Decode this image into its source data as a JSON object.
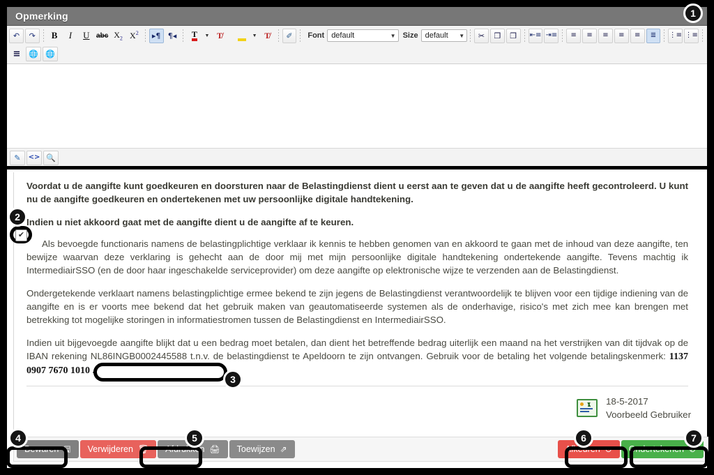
{
  "editor": {
    "title": "Opmerking",
    "toolbar_row1": [
      {
        "name": "undo-icon",
        "glyph": "↶"
      },
      {
        "name": "redo-icon",
        "glyph": "↷"
      },
      {
        "name": "bold-icon",
        "glyph": "B"
      },
      {
        "name": "italic-icon",
        "glyph": "I"
      },
      {
        "name": "underline-icon",
        "glyph": "U"
      },
      {
        "name": "strikethrough-icon",
        "glyph": "abc"
      },
      {
        "name": "subscript-icon",
        "glyph": "X"
      },
      {
        "name": "superscript-icon",
        "glyph": "X"
      },
      {
        "name": "ltr-paragraph-icon",
        "glyph": "¶"
      },
      {
        "name": "rtl-paragraph-icon",
        "glyph": "¶"
      },
      {
        "name": "text-color-icon",
        "glyph": "T"
      },
      {
        "name": "text-color-dropdown-icon",
        "glyph": "▾"
      },
      {
        "name": "remove-text-color-icon",
        "glyph": "T"
      },
      {
        "name": "highlight-color-icon",
        "glyph": "◇"
      },
      {
        "name": "highlight-dropdown-icon",
        "glyph": "▾"
      },
      {
        "name": "remove-highlight-icon",
        "glyph": "T"
      },
      {
        "name": "remove-format-icon",
        "glyph": "⌫"
      }
    ],
    "font_label": "Font",
    "font_value": "default",
    "size_label": "Size",
    "size_value": "default",
    "toolbar_row1_right": [
      {
        "name": "cut-icon",
        "glyph": "✂"
      },
      {
        "name": "copy-icon",
        "glyph": "❐"
      },
      {
        "name": "paste-word-icon",
        "glyph": "❐"
      },
      {
        "name": "outdent-icon",
        "glyph": "⇤"
      },
      {
        "name": "indent-icon",
        "glyph": "⇥"
      },
      {
        "name": "align-justify-icon",
        "glyph": "≡"
      },
      {
        "name": "align-left-icon",
        "glyph": "≡"
      },
      {
        "name": "align-center-icon",
        "glyph": "≡"
      },
      {
        "name": "align-right-icon",
        "glyph": "≡"
      },
      {
        "name": "align-block-icon",
        "glyph": "≡"
      },
      {
        "name": "align-full-icon",
        "glyph": "≡"
      },
      {
        "name": "numbered-list-icon",
        "glyph": "☰"
      },
      {
        "name": "bullet-list-icon",
        "glyph": "☰"
      }
    ],
    "toolbar_row2": [
      {
        "name": "horizontal-rule-icon",
        "glyph": "≡"
      },
      {
        "name": "insert-link-icon",
        "glyph": "🌐"
      },
      {
        "name": "remove-link-icon",
        "glyph": "🌐"
      }
    ],
    "footer_tabs": [
      {
        "name": "design-view-icon",
        "glyph": "✎"
      },
      {
        "name": "source-view-icon",
        "glyph": "<>"
      },
      {
        "name": "preview-icon",
        "glyph": "🔍"
      }
    ],
    "content": ""
  },
  "document": {
    "intro": "Voordat u de aangifte kunt goedkeuren en doorsturen naar de Belastingdienst dient u eerst aan te geven dat u de aangifte heeft gecontroleerd. U kunt nu de aangifte goedkeuren en ondertekenen met uw persoonlijke digitale handtekening.",
    "reject_note": "Indien u niet akkoord gaat met de aangifte dient u de aangifte af te keuren.",
    "checkbox_checked": true,
    "declaration": "Als bevoegde functionaris namens de belastingplichtige verklaar ik kennis te hebben genomen van en akkoord te gaan met de inhoud van deze aangifte, ten bewijze waarvan deze verklaring is gehecht aan de door mij met mijn persoonlijke digitale handtekening ondertekende aangifte. Tevens machtig ik IntermediairSSO (en de door haar ingeschakelde serviceprovider) om deze aangifte op elektronische wijze te verzenden aan de Belastingdienst.",
    "liability": "Ondergetekende verklaart namens belastingplichtige ermee bekend te zijn jegens de Belastingdienst verantwoordelijk te blijven voor een tijdige indiening van de aangifte en is er voorts mee bekend dat het gebruik maken van geautomatiseerde systemen als de onderhavige, risico's met zich mee kan brengen met betrekking tot mogelijke storingen in informatiestromen tussen de Belastingdienst en IntermediairSSO.",
    "payment_prefix": "Indien uit bijgevoegde aangifte blijkt dat u een bedrag moet betalen, dan dient het betreffende bedrag uiterlijk een maand na het verstrijken van dit tijdvak op de IBAN rekening NL86INGB0002445588 t.n.v. de belastingdienst te Apeldoorn te zijn ontvangen. Gebruik voor de betaling het volgende betalingskenmerk:",
    "payment_reference": "1137 0907 7670 1010 .",
    "signature": {
      "icon": "signature-stamp-icon",
      "date": "18-5-2017",
      "user": "Voorbeeld Gebruiker"
    }
  },
  "buttons": {
    "left": [
      {
        "name": "save-button",
        "label": "Bewaren",
        "icon": "save-icon",
        "glyph": "🖫",
        "style": "grey"
      },
      {
        "name": "delete-button",
        "label": "Verwijderen",
        "icon": "trash-icon",
        "glyph": "🗑",
        "style": "red"
      },
      {
        "name": "print-button",
        "label": "Afdrukken",
        "icon": "printer-icon",
        "glyph": "🖨",
        "style": "grey2"
      },
      {
        "name": "assign-button",
        "label": "Toewijzen",
        "icon": "assign-share-icon",
        "glyph": "⇗",
        "style": "grey2"
      }
    ],
    "right": [
      {
        "name": "reject-button",
        "label": "Afkeuren",
        "icon": "minus-circle-icon",
        "glyph": "⊖",
        "style": "red-dark"
      },
      {
        "name": "sign-button",
        "label": "Ondertekenen",
        "icon": "check-circle-icon",
        "glyph": "⊘",
        "style": "green"
      }
    ]
  },
  "callouts": [
    {
      "number": "1",
      "target": "editor-panel"
    },
    {
      "number": "2",
      "target": "agreement-checkbox"
    },
    {
      "number": "3",
      "target": "payment-reference"
    },
    {
      "number": "4",
      "target": "save-button"
    },
    {
      "number": "5",
      "target": "print-button"
    },
    {
      "number": "6",
      "target": "reject-button"
    },
    {
      "number": "7",
      "target": "sign-button"
    }
  ],
  "colors": {
    "accent_red": "#e8504a",
    "accent_green": "#49b04a",
    "accent_grey": "#808080",
    "titlebar": "#777777",
    "body_text": "#4a4a42"
  }
}
